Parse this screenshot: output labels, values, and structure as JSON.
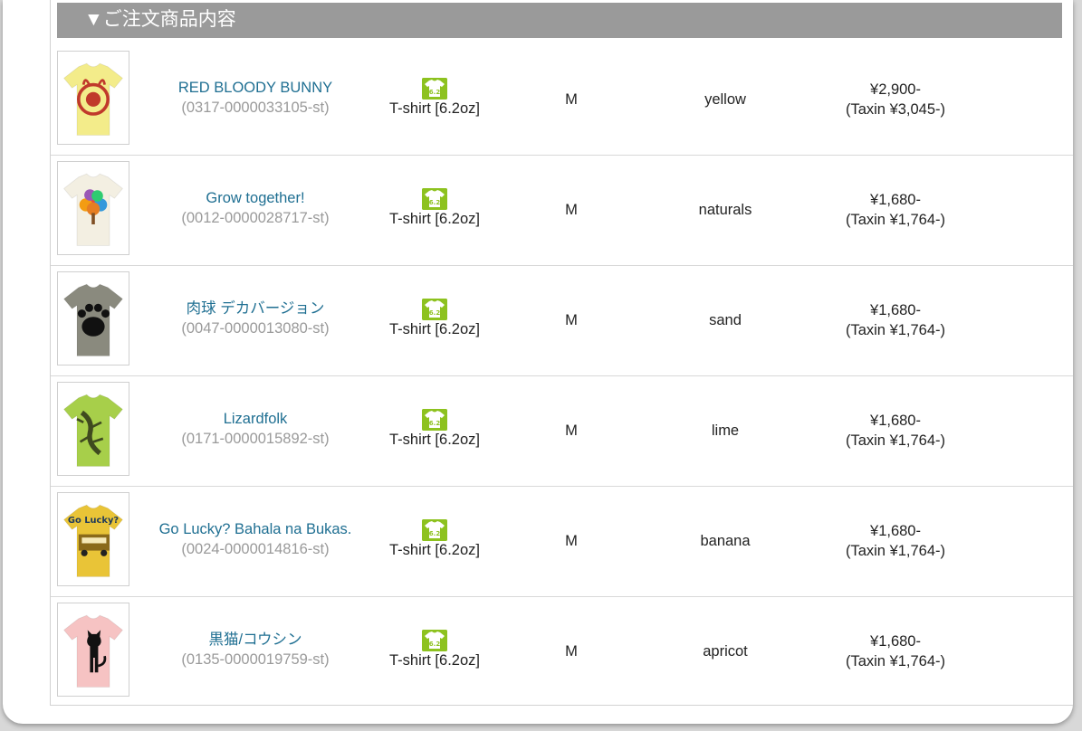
{
  "section_header": "▼ご注文商品内容",
  "items": [
    {
      "name": "RED BLOODY BUNNY",
      "code": "(0317-0000033105-st)",
      "type": "T-shirt [6.2oz]",
      "size": "M",
      "color": "yellow",
      "price": "¥2,900-",
      "tax_price": "(Taxin ¥3,045-)",
      "shirt_color": "#f3ec8a",
      "design": "bunny"
    },
    {
      "name": "Grow together!",
      "code": "(0012-0000028717-st)",
      "type": "T-shirt [6.2oz]",
      "size": "M",
      "color": "naturals",
      "price": "¥1,680-",
      "tax_price": "(Taxin ¥1,764-)",
      "shirt_color": "#f3efe2",
      "design": "tree"
    },
    {
      "name": "肉球 デカバージョン",
      "code": "(0047-0000013080-st)",
      "type": "T-shirt [6.2oz]",
      "size": "M",
      "color": "sand",
      "price": "¥1,680-",
      "tax_price": "(Taxin ¥1,764-)",
      "shirt_color": "#8a8a7e",
      "design": "paw"
    },
    {
      "name": "Lizardfolk",
      "code": "(0171-0000015892-st)",
      "type": "T-shirt [6.2oz]",
      "size": "M",
      "color": "lime",
      "price": "¥1,680-",
      "tax_price": "(Taxin ¥1,764-)",
      "shirt_color": "#a7cf4a",
      "design": "lizard"
    },
    {
      "name": "Go Lucky? Bahala na Bukas.",
      "code": "(0024-0000014816-st)",
      "type": "T-shirt [6.2oz]",
      "size": "M",
      "color": "banana",
      "price": "¥1,680-",
      "tax_price": "(Taxin ¥1,764-)",
      "shirt_color": "#e9c437",
      "design": "jeep"
    },
    {
      "name": "黒猫/コウシン",
      "code": "(0135-0000019759-st)",
      "type": "T-shirt [6.2oz]",
      "size": "M",
      "color": "apricot",
      "price": "¥1,680-",
      "tax_price": "(Taxin ¥1,764-)",
      "shirt_color": "#f6c3c3",
      "design": "cat"
    }
  ],
  "icons": {
    "type_icon": "tshirt-6.2-icon",
    "type_icon_color": "#8dc21f",
    "type_icon_text": "6.2"
  }
}
